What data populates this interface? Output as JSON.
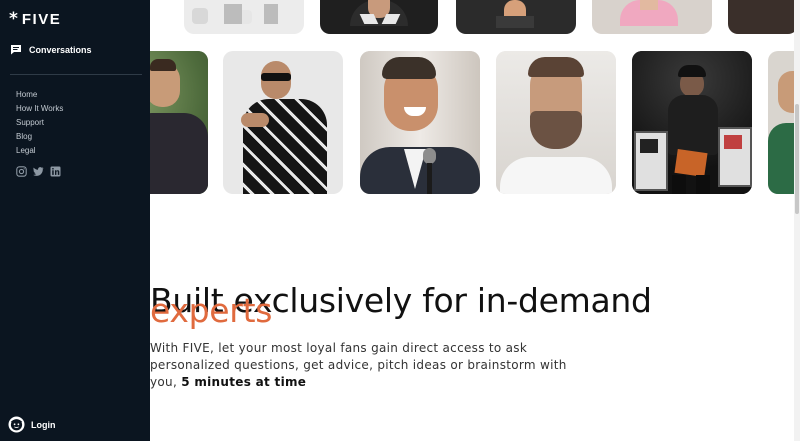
{
  "sidebar": {
    "logo": {
      "mark": "*",
      "text": "FIVE"
    },
    "conversations_label": "Conversations",
    "nav": [
      "Home",
      "How It Works",
      "Support",
      "Blog",
      "Legal"
    ],
    "socials": [
      "instagram-icon",
      "twitter-icon",
      "linkedin-icon"
    ],
    "login_label": "Login"
  },
  "hero": {
    "headline_line1": "Built exclusively for in-demand",
    "headline_line2": "experts",
    "body_prefix": "With FIVE, let your most loyal fans gain direct access to ask personalized questions, get advice, pitch ideas or brainstorm with you,",
    "body_emphasis": "5 minutes at time"
  },
  "colors": {
    "sidebar_bg": "#0b1520",
    "accent": "#e06a3e",
    "text": "#111111"
  }
}
